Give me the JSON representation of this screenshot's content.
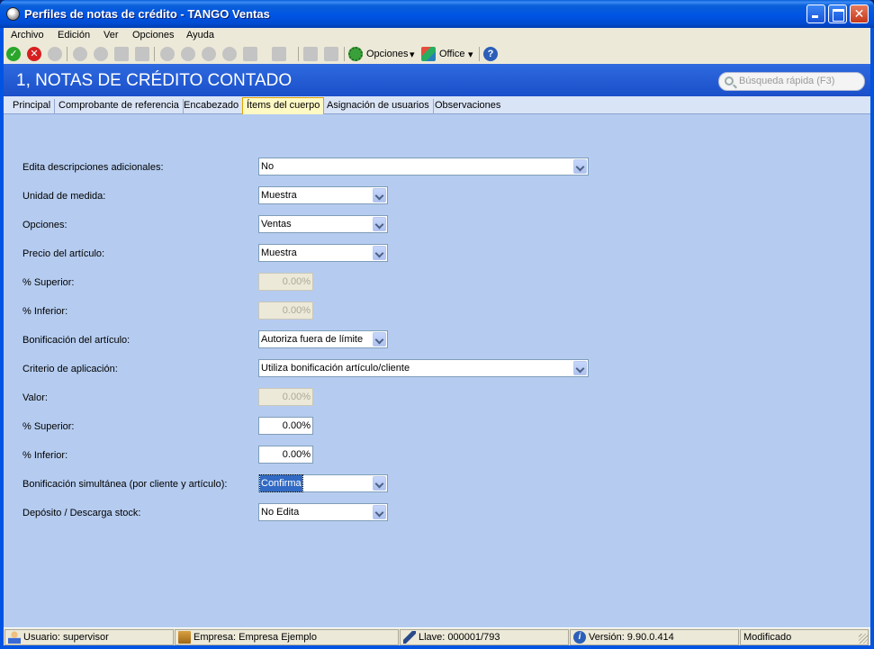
{
  "window": {
    "title": "Perfiles de notas de crédito - TANGO Ventas",
    "minimize": "_",
    "maximize": "□",
    "close": "✕"
  },
  "menu": [
    "Archivo",
    "Edición",
    "Ver",
    "Opciones",
    "Ayuda"
  ],
  "toolbar": {
    "options_label": "Opciones",
    "office_label": "Office",
    "help_glyph": "?"
  },
  "header": {
    "title": "1, NOTAS DE CRÉDITO CONTADO",
    "search_placeholder": "Búsqueda rápida (F3)"
  },
  "tabs": [
    {
      "label": "Principal",
      "active": false
    },
    {
      "label": "Comprobante de referencia",
      "active": false
    },
    {
      "label": "Encabezado",
      "active": false
    },
    {
      "label": "Ítems del cuerpo",
      "active": true
    },
    {
      "label": "Asignación de usuarios",
      "active": false
    },
    {
      "label": "Observaciones",
      "active": false
    }
  ],
  "form": {
    "fields": [
      {
        "label": "Edita descripciones adicionales:",
        "value": "No"
      },
      {
        "label": "Unidad de medida:",
        "value": "Muestra"
      },
      {
        "label": "Opciones:",
        "value": "Ventas"
      },
      {
        "label": "Precio del artículo:",
        "value": "Muestra"
      },
      {
        "label": "% Superior:",
        "value": "0.00%"
      },
      {
        "label": "% Inferior:",
        "value": "0.00%"
      },
      {
        "label": "Bonificación del artículo:",
        "value": "Autoriza fuera de límite"
      },
      {
        "label": "Criterio de aplicación:",
        "value": "Utiliza bonificación artículo/cliente"
      },
      {
        "label": "Valor:",
        "value": "0.00%"
      },
      {
        "label": "% Superior:",
        "value": "0.00%"
      },
      {
        "label": "% Inferior:",
        "value": "0.00%"
      },
      {
        "label": "Bonificación simultánea (por cliente y artículo):",
        "value": "Confirma"
      },
      {
        "label": "Depósito / Descarga stock:",
        "value": "No Edita"
      }
    ]
  },
  "status": {
    "user": "Usuario: supervisor",
    "company": "Empresa: Empresa Ejemplo",
    "key": "Llave: 000001/793",
    "version": "Versión: 9.90.0.414",
    "state": "Modificado"
  }
}
